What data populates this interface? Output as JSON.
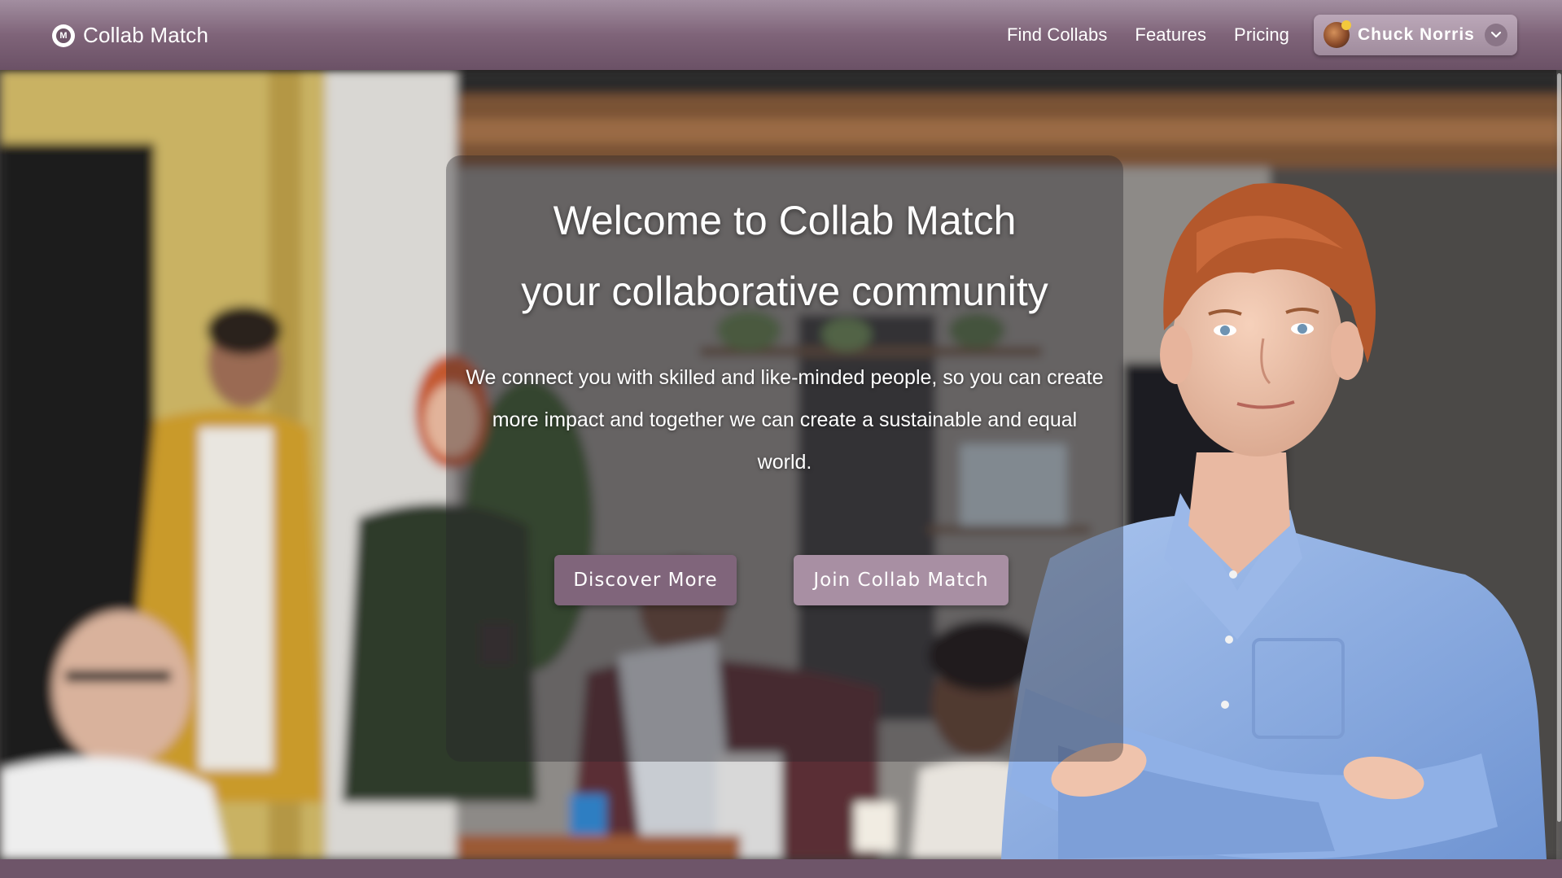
{
  "app": {
    "brand_name": "Collab Match",
    "brand_logo_letter": "M"
  },
  "nav": {
    "links": [
      "Find Collabs",
      "Features",
      "Pricing"
    ],
    "user_name": "Chuck Norris"
  },
  "hero": {
    "title_line1": "Welcome to Collab Match",
    "title_line2": "your collaborative community",
    "description": "We connect you with skilled and like-minded people, so you can create more impact and together we can create a sustainable and equal world.",
    "primary_button": "Discover More",
    "secondary_button": "Join Collab Match"
  },
  "colors": {
    "nav_bg": "#7f6479",
    "button_primary": "#80657b",
    "button_secondary": "#a88fa3",
    "footer_strip": "#6e5569"
  },
  "icons": {
    "brand": "collab-match-logo-icon",
    "dropdown": "chevron-down-icon",
    "avatar": "user-avatar"
  }
}
